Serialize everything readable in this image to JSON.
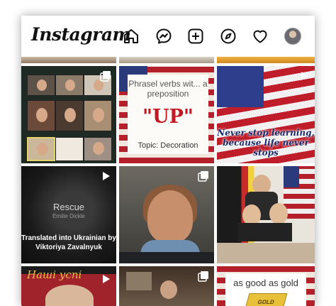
{
  "header": {
    "logo": "Instagram",
    "icons": [
      "home-icon",
      "messenger-icon",
      "new-post-icon",
      "explore-icon",
      "activity-heart-icon",
      "profile-avatar"
    ]
  },
  "posts": {
    "zoom": {
      "badge": "multiple-icon"
    },
    "phrasal": {
      "title": "Phrasel verbs wit... a preposition",
      "word": "\"UP\"",
      "topic": "Topic: Decoration"
    },
    "flag": {
      "badge": "reel-icon",
      "caption": "Never stop learning, because life never stops"
    },
    "rescue": {
      "badge": "reel-icon",
      "title": "Rescue",
      "author": "Emilie Dickle",
      "caption": "Translated into Ukrainian by Viktoriya Zavalnyuk"
    },
    "videocall": {
      "badge": "multiple-icon"
    },
    "students": {},
    "nashi": {
      "title": "Наші успі",
      "badge": "reel-icon"
    },
    "room": {
      "badge": "multiple-icon"
    },
    "gold": {
      "text": "as good as gold",
      "bar": "GOLD"
    }
  },
  "colors": {
    "accent_red": "#b3202a",
    "navy": "#2a3a7a"
  }
}
